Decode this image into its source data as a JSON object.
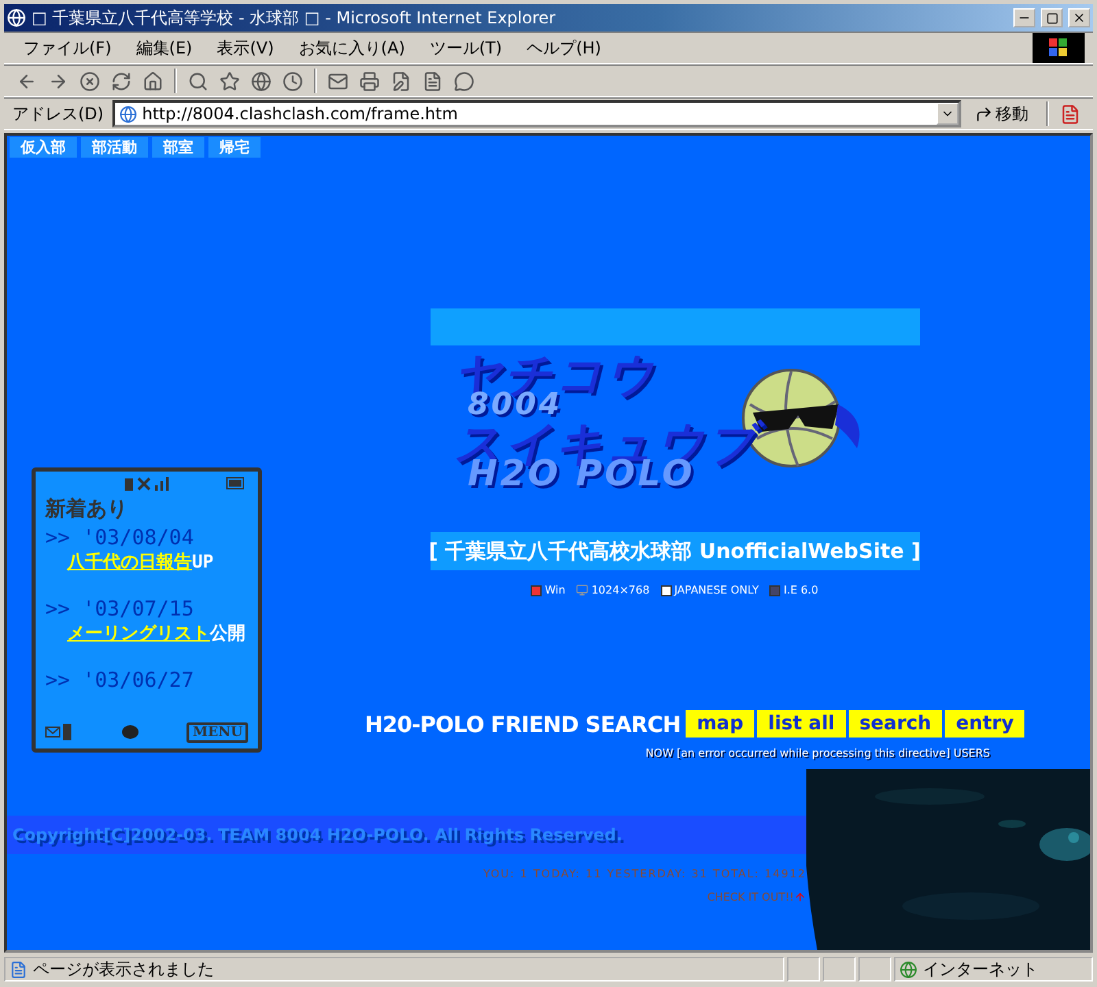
{
  "window": {
    "title": "□ 千葉県立八千代高等学校 - 水球部 □ - Microsoft Internet Explorer"
  },
  "menu": [
    "ファイル(F)",
    "編集(E)",
    "表示(V)",
    "お気に入り(A)",
    "ツール(T)",
    "ヘルプ(H)"
  ],
  "address": {
    "label": "アドレス(D)",
    "value": "http://8004.clashclash.com/frame.htm",
    "go": "移動"
  },
  "nav": [
    "仮入部",
    "部活動",
    "部室",
    "帰宅"
  ],
  "logo": {
    "top": "ヤチコウ",
    "number": "8004",
    "middle": "スイキュウブ",
    "bottom": "H2O POLO"
  },
  "site_title": "[ 千葉県立八千代高校水球部 UnofficialWebSite ]",
  "badges": [
    {
      "kind": "win",
      "label": "Win"
    },
    {
      "kind": "monitor",
      "label": "1024×768"
    },
    {
      "kind": "flag",
      "label": "JAPANESE ONLY"
    },
    {
      "kind": "ie",
      "label": "I.E 6.0"
    }
  ],
  "phone": {
    "heading": "新着あり",
    "news": [
      {
        "date": ">> '03/08/04",
        "link": "八千代の日報告",
        "suffix": "UP"
      },
      {
        "date": ">> '03/07/15",
        "link": "メーリングリスト",
        "suffix": "公開"
      },
      {
        "date": ">> '03/06/27"
      }
    ],
    "menu": "MENU"
  },
  "friend_search": {
    "title": "H20-POLO FRIEND SEARCH",
    "buttons": [
      "map",
      "list all",
      "search",
      "entry"
    ],
    "users": "NOW [an error occurred while processing this directive] USERS"
  },
  "copyright": "Copyright[C]2002-03. TEAM 8004 H2O-POLO. All Rights Reserved.",
  "counter": "YOU: 1 TODAY: 11 YESTERDAY: 31 TOTAL: 14912",
  "check": "CHECK IT OUT!!",
  "status_bar": {
    "text": "ページが表示されました",
    "zone": "インターネット"
  }
}
